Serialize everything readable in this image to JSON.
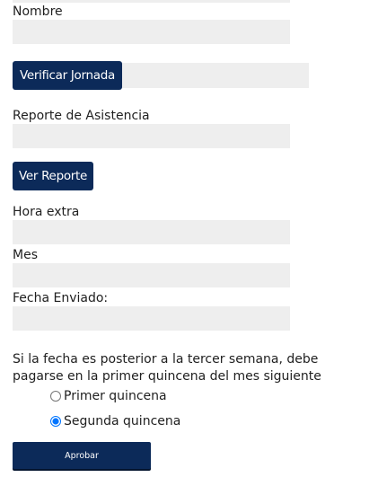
{
  "form": {
    "nombre": {
      "label": "Nombre",
      "value": ""
    },
    "verificar_button": "Verificar Jornada",
    "verificar_value": "",
    "reporte": {
      "label": "Reporte de Asistencia",
      "value": ""
    },
    "ver_reporte_button": "Ver Reporte",
    "hora_extra": {
      "label": "Hora extra",
      "value": ""
    },
    "mes": {
      "label": "Mes",
      "value": ""
    },
    "fecha_enviado": {
      "label": "Fecha Enviado:",
      "value": ""
    },
    "note": "Si la fecha es posterior a la tercer semana, debe pagarse en la primer quincena del mes siguiente",
    "options": [
      {
        "label": "Primer quincena",
        "selected": false
      },
      {
        "label": "Segunda quincena",
        "selected": true
      }
    ],
    "approve_button": "Aprobar"
  },
  "colors": {
    "button_bg": "#0c2a59",
    "field_bg": "#eeeeee"
  }
}
